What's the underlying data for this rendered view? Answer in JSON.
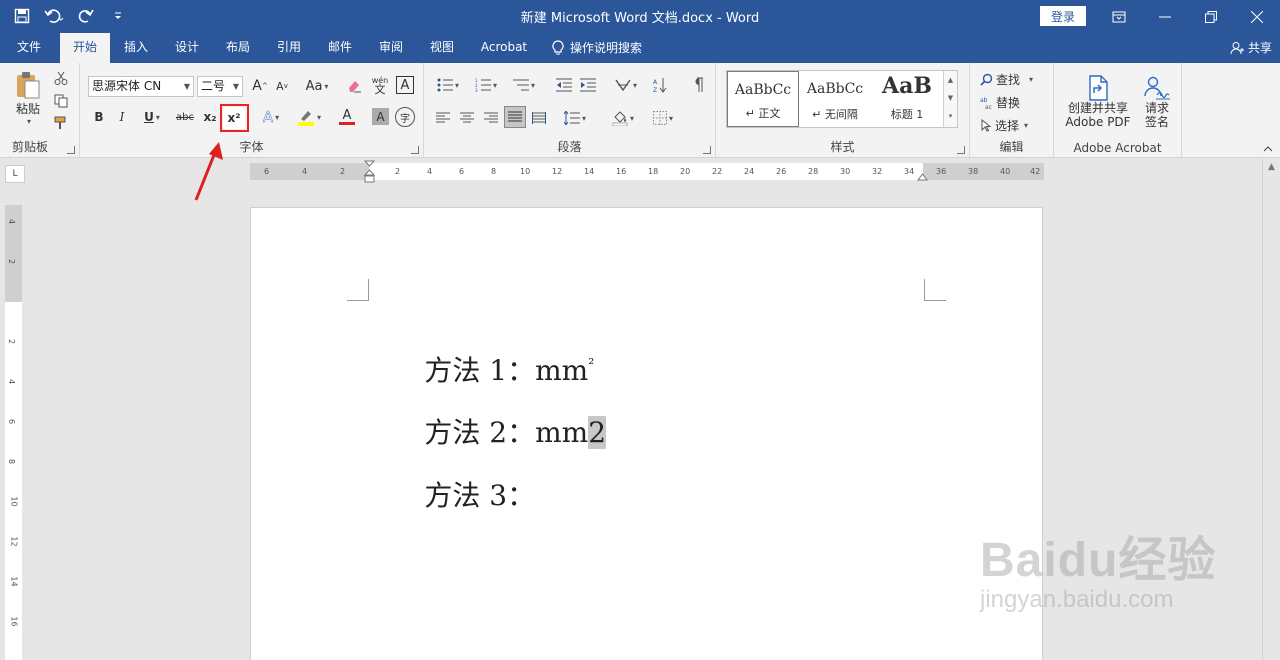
{
  "window": {
    "title": "新建 Microsoft Word 文档.docx  -  Word",
    "login_label": "登录"
  },
  "tabs": [
    "文件",
    "开始",
    "插入",
    "设计",
    "布局",
    "引用",
    "邮件",
    "审阅",
    "视图",
    "Acrobat"
  ],
  "tell_me": "操作说明搜索",
  "share_label": "共享",
  "clipboard": {
    "paste_label": "粘贴",
    "group_label": "剪贴板"
  },
  "font": {
    "name": "思源宋体 CN",
    "size": "二号",
    "group_label": "字体",
    "bold": "B",
    "italic": "I",
    "underline": "U",
    "strike": "abc",
    "subscript": "x₂",
    "superscript": "x²",
    "grow": "A",
    "shrink": "A",
    "case": "Aa",
    "phonetic": "wén",
    "border_char": "A",
    "effects": "A",
    "font_color": "A",
    "char_shade": "A",
    "enclose": "字"
  },
  "paragraph": {
    "group_label": "段落"
  },
  "styles": {
    "group_label": "样式",
    "items": [
      {
        "sample": "AaBbCc",
        "name": "↵ 正文"
      },
      {
        "sample": "AaBbCc",
        "name": "↵ 无间隔"
      },
      {
        "sample": "AaB",
        "name": "标题 1"
      }
    ]
  },
  "editing": {
    "group_label": "编辑",
    "find": "查找",
    "replace": "替换",
    "select": "选择"
  },
  "acrobat": {
    "group_label": "Adobe Acrobat",
    "create_share": "创建并共享",
    "create_share_2": "Adobe PDF",
    "request_sign": "请求",
    "request_sign_2": "签名"
  },
  "ruler": {
    "corner": "L",
    "left_ticks": [
      "6",
      "4",
      "2"
    ],
    "ticks": [
      "2",
      "4",
      "6",
      "8",
      "10",
      "12",
      "14",
      "16",
      "18",
      "20",
      "22",
      "24",
      "26",
      "28",
      "30",
      "32",
      "34",
      "36",
      "38",
      "40",
      "42"
    ],
    "v_ticks": [
      "4",
      "2",
      "2",
      "4",
      "6",
      "8",
      "10",
      "12",
      "14",
      "16"
    ]
  },
  "document": {
    "lines": [
      {
        "label": "方法 1：",
        "text": "mm",
        "sup": "²",
        "sel": ""
      },
      {
        "label": "方法 2：",
        "text": "mm",
        "sup": "",
        "sel": "2"
      },
      {
        "label": "方法 3：",
        "text": "",
        "sup": "",
        "sel": ""
      }
    ]
  },
  "watermark": {
    "logo": "Baidu经验",
    "url": "jingyan.baidu.com"
  },
  "colors": {
    "title_bar": "#2b579a",
    "ribbon": "#f3f3f3",
    "highlight_box": "#e22222",
    "font_color_bar": "#e02020",
    "highlighter_bar": "#ffff00"
  }
}
